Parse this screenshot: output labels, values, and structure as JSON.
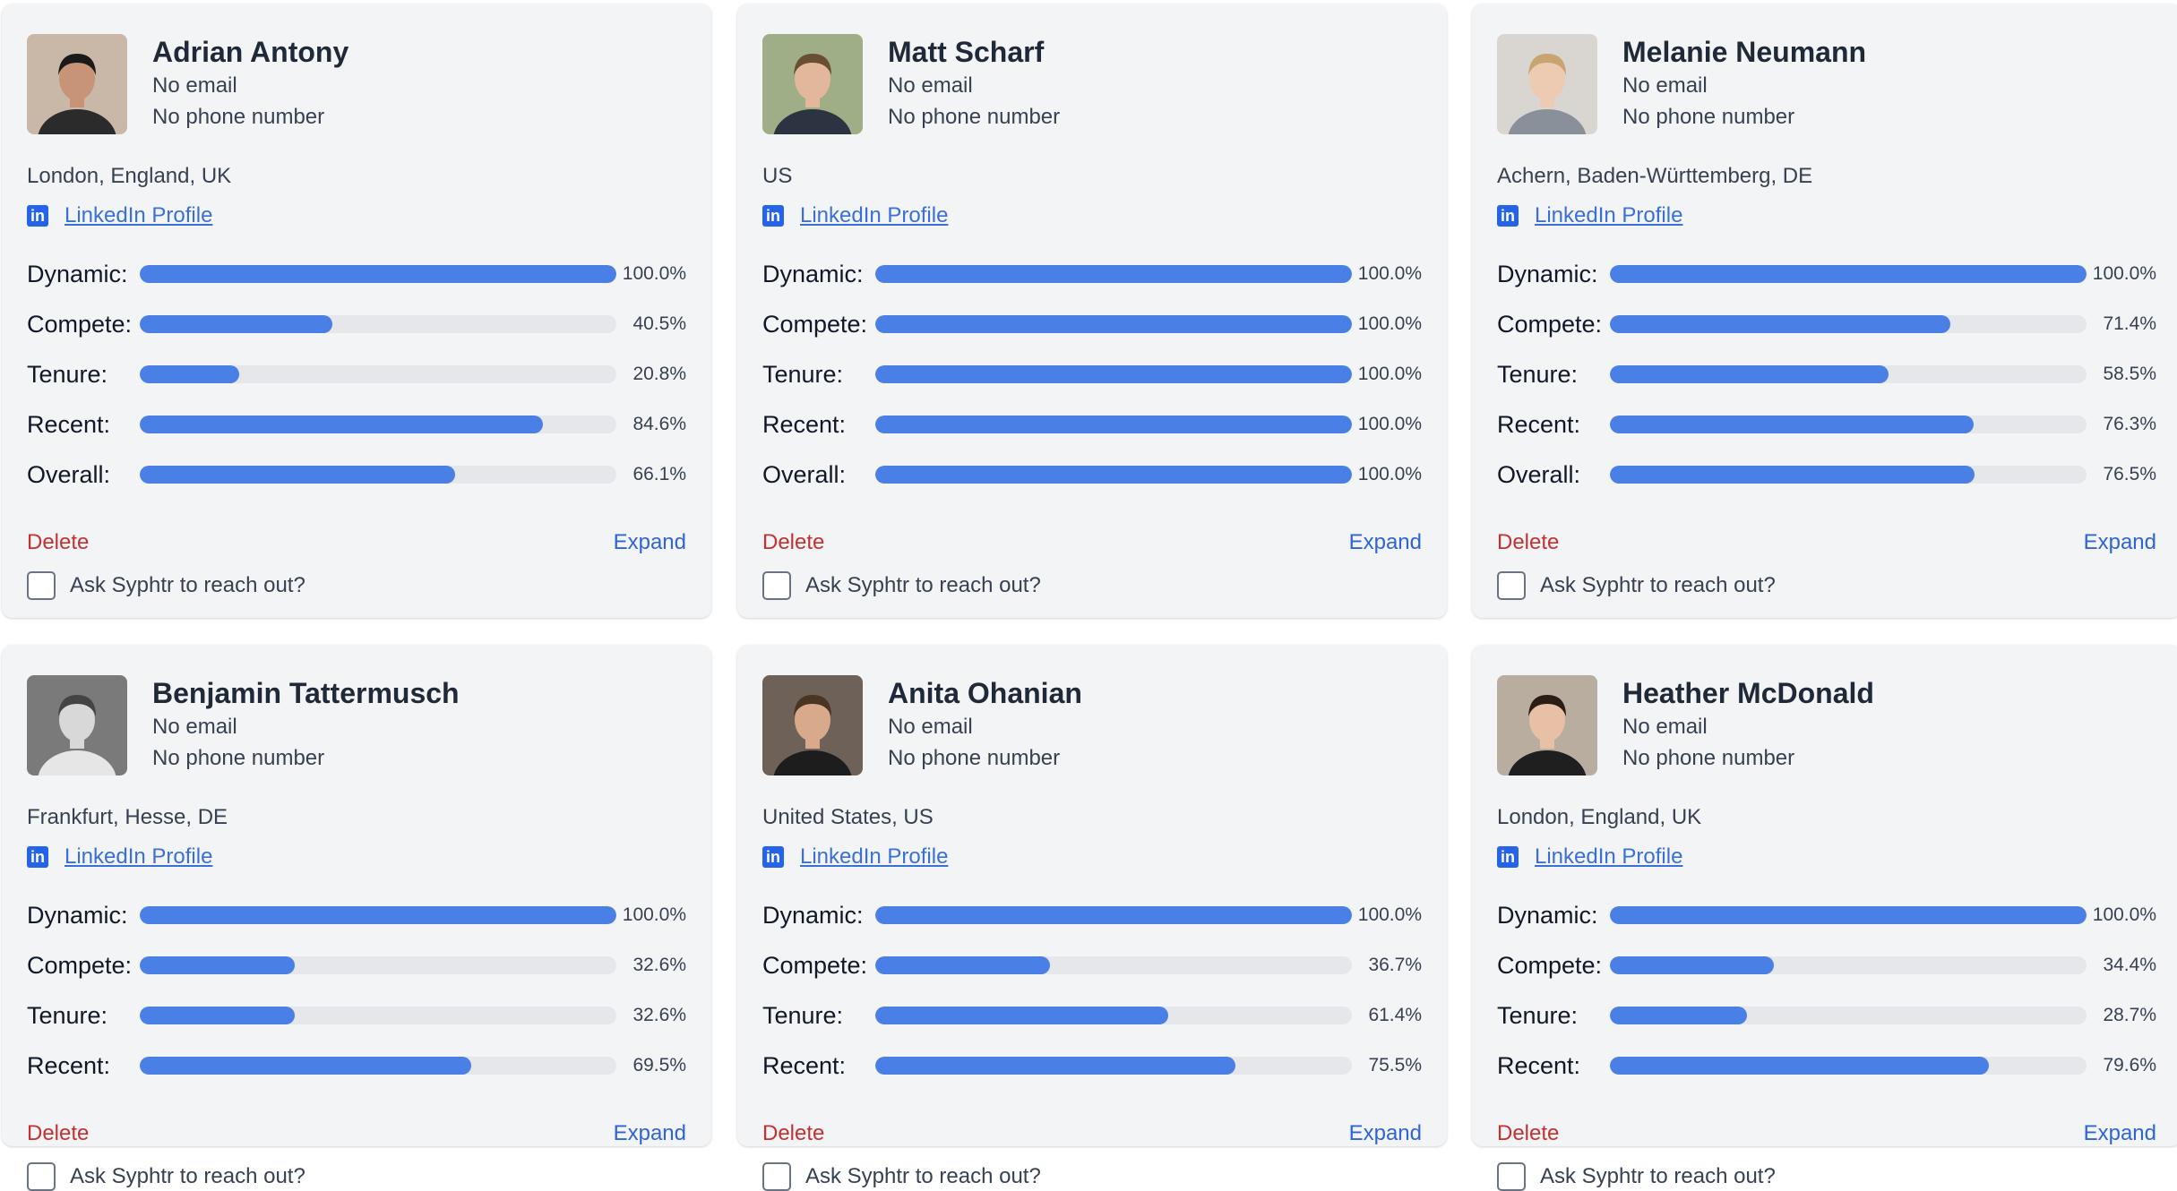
{
  "labels": {
    "linkedin": "LinkedIn Profile",
    "delete": "Delete",
    "expand": "Expand",
    "reach_out": "Ask Syphtr to reach out?",
    "linkedin_icon_text": "in"
  },
  "metric_labels": [
    "Dynamic:",
    "Compete:",
    "Tenure:",
    "Recent:",
    "Overall:"
  ],
  "colors": {
    "bar": "#4a7fe5",
    "track": "#e5e7eb",
    "delete": "#c53030",
    "expand": "#2f64d6",
    "link": "#3b6fd8"
  },
  "candidates": [
    {
      "name": "Adrian Antony",
      "email": "No email",
      "phone": "No phone number",
      "location": "London, England, UK",
      "avatar": "portrait-photo",
      "metrics": [
        {
          "value": 100.0,
          "text": "100.0%"
        },
        {
          "value": 40.5,
          "text": "40.5%"
        },
        {
          "value": 20.8,
          "text": "20.8%"
        },
        {
          "value": 84.6,
          "text": "84.6%"
        },
        {
          "value": 66.1,
          "text": "66.1%"
        }
      ]
    },
    {
      "name": "Matt Scharf",
      "email": "No email",
      "phone": "No phone number",
      "location": "US",
      "avatar": "portrait-photo",
      "metrics": [
        {
          "value": 100.0,
          "text": "100.0%"
        },
        {
          "value": 100.0,
          "text": "100.0%"
        },
        {
          "value": 100.0,
          "text": "100.0%"
        },
        {
          "value": 100.0,
          "text": "100.0%"
        },
        {
          "value": 100.0,
          "text": "100.0%"
        }
      ]
    },
    {
      "name": "Melanie Neumann",
      "email": "No email",
      "phone": "No phone number",
      "location": "Achern, Baden-Württemberg, DE",
      "avatar": "portrait-photo",
      "metrics": [
        {
          "value": 100.0,
          "text": "100.0%"
        },
        {
          "value": 71.4,
          "text": "71.4%"
        },
        {
          "value": 58.5,
          "text": "58.5%"
        },
        {
          "value": 76.3,
          "text": "76.3%"
        },
        {
          "value": 76.5,
          "text": "76.5%"
        }
      ]
    },
    {
      "name": "Benjamin Tattermusch",
      "email": "No email",
      "phone": "No phone number",
      "location": "Frankfurt, Hesse, DE",
      "avatar": "portrait-photo",
      "metrics": [
        {
          "value": 100.0,
          "text": "100.0%"
        },
        {
          "value": 32.6,
          "text": "32.6%"
        },
        {
          "value": 32.6,
          "text": "32.6%"
        },
        {
          "value": 69.5,
          "text": "69.5%"
        }
      ]
    },
    {
      "name": "Anita Ohanian",
      "email": "No email",
      "phone": "No phone number",
      "location": "United States, US",
      "avatar": "portrait-photo",
      "metrics": [
        {
          "value": 100.0,
          "text": "100.0%"
        },
        {
          "value": 36.7,
          "text": "36.7%"
        },
        {
          "value": 61.4,
          "text": "61.4%"
        },
        {
          "value": 75.5,
          "text": "75.5%"
        }
      ]
    },
    {
      "name": "Heather McDonald",
      "email": "No email",
      "phone": "No phone number",
      "location": "London, England, UK",
      "avatar": "portrait-photo",
      "metrics": [
        {
          "value": 100.0,
          "text": "100.0%"
        },
        {
          "value": 34.4,
          "text": "34.4%"
        },
        {
          "value": 28.7,
          "text": "28.7%"
        },
        {
          "value": 79.6,
          "text": "79.6%"
        }
      ]
    }
  ]
}
